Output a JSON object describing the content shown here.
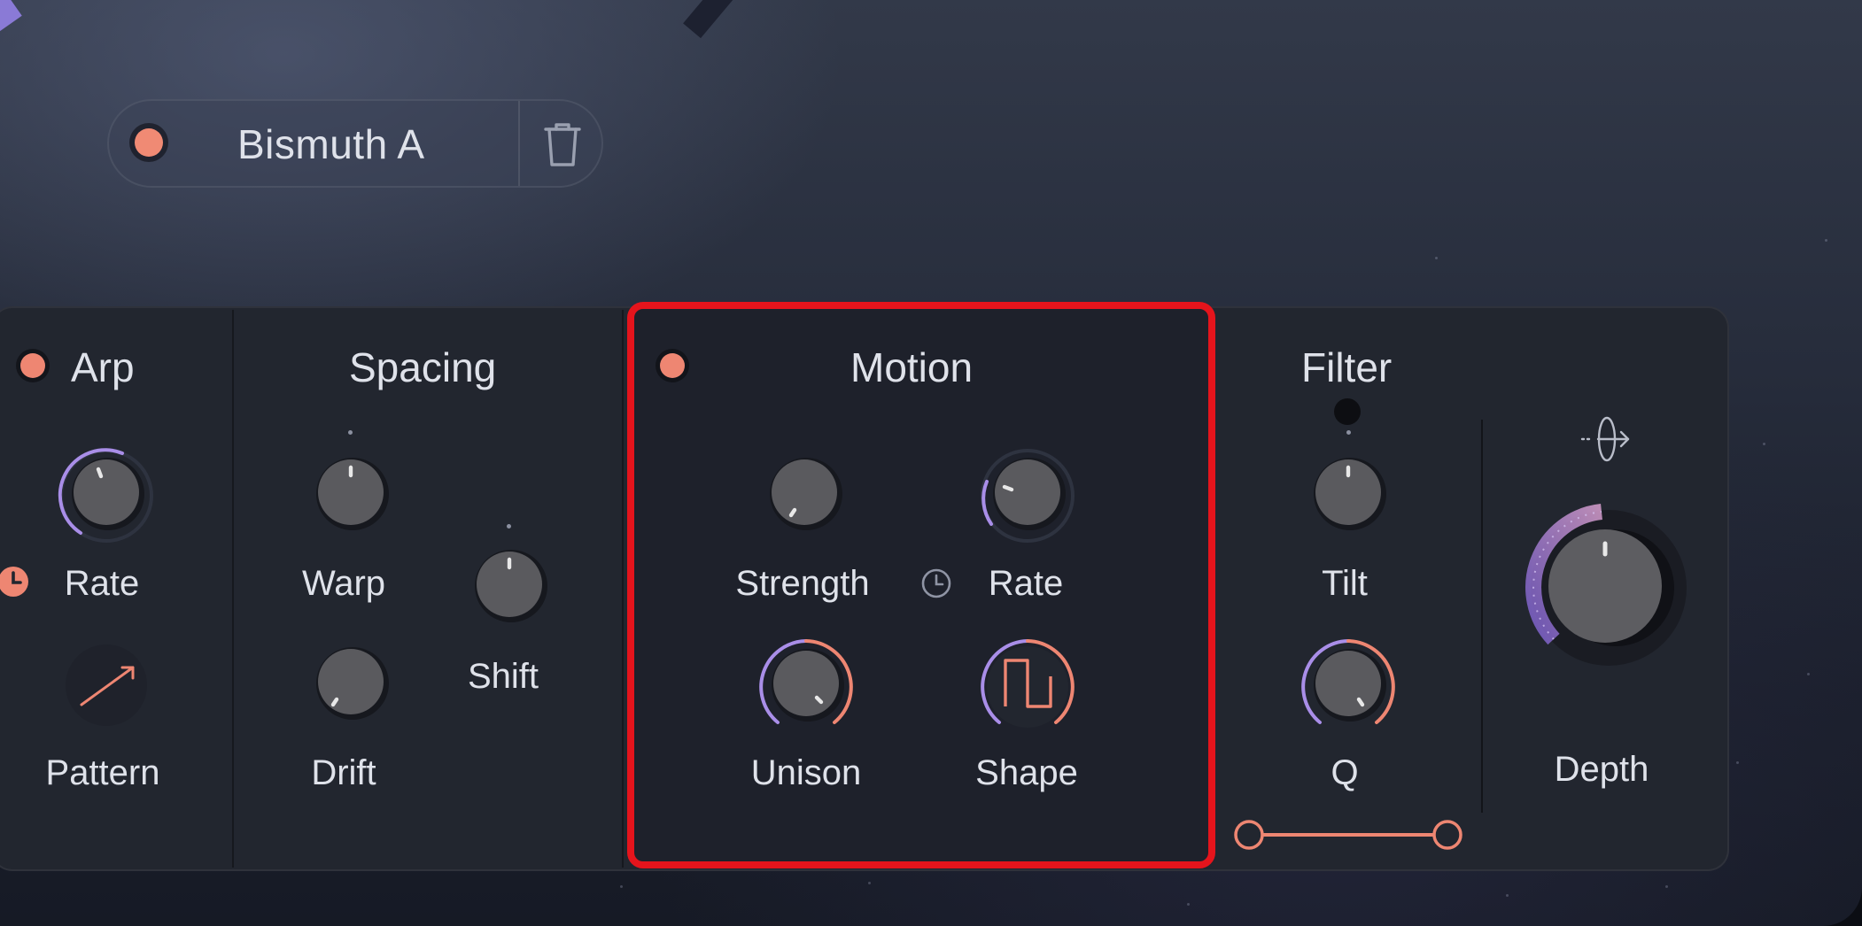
{
  "preset": {
    "name": "Bismuth A",
    "power_color": "#f08a74",
    "delete_icon": "trash-icon"
  },
  "sections": {
    "arp": {
      "title": "Arp",
      "rate_label": "Rate",
      "pattern_label": "Pattern",
      "sync_icon": "clock-icon"
    },
    "spacing": {
      "title": "Spacing",
      "warp_label": "Warp",
      "drift_label": "Drift",
      "shift_label": "Shift"
    },
    "motion": {
      "title": "Motion",
      "strength_label": "Strength",
      "rate_label": "Rate",
      "unison_label": "Unison",
      "shape_label": "Shape",
      "sync_icon": "clock-icon",
      "shape_icon": "square-wave-icon"
    },
    "filter": {
      "title": "Filter",
      "tilt_label": "Tilt",
      "q_label": "Q",
      "range_icon": "range-slider"
    },
    "depth": {
      "label": "Depth",
      "route_icon": "output-route-icon"
    }
  },
  "colors": {
    "accent_coral": "#ee8672",
    "accent_violet": "#a98ee8",
    "highlight_red": "#e5141c",
    "panel": "#22262f"
  }
}
